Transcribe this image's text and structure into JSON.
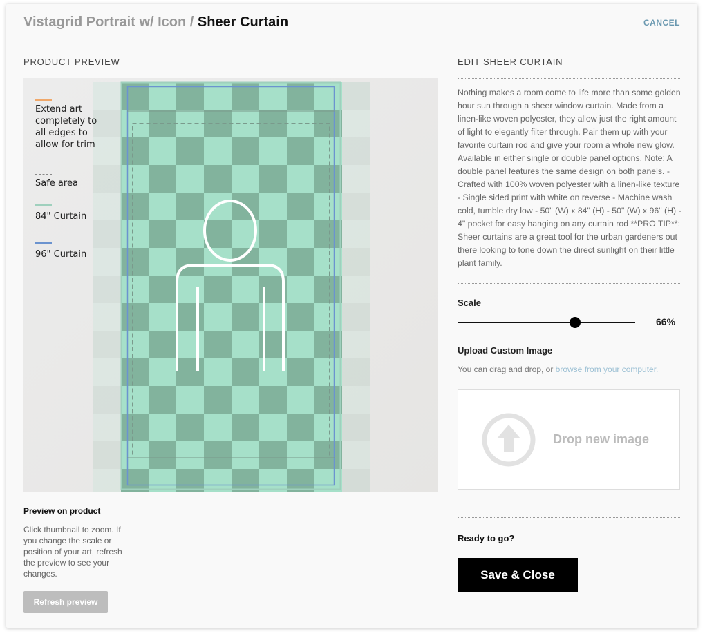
{
  "header": {
    "breadcrumb": "Vistagrid Portrait w/ Icon /",
    "title": "Sheer Curtain",
    "cancel_label": "CANCEL"
  },
  "preview": {
    "section_label": "PRODUCT PREVIEW",
    "legend": {
      "extend_art": "Extend art completely to all edges to allow for trim",
      "safe_area": "Safe area",
      "curtain_84": "84\" Curtain",
      "curtain_96": "96\" Curtain"
    },
    "colors": {
      "extend_art": "#f0a86a",
      "curtain_84": "#9fd0bd",
      "curtain_96": "#6b93cf",
      "check_light": "#a6e0c9",
      "check_dark": "#82b39d"
    },
    "icons": [
      "person-icon"
    ],
    "caption": "Preview on product",
    "help": "Click thumbnail to zoom. If you change the scale or position of your art, refresh the preview to see your changes.",
    "refresh_label": "Refresh preview"
  },
  "editor": {
    "section_label": "EDIT SHEER CURTAIN",
    "description": "Nothing makes a room come to life more than some golden hour sun through a sheer window curtain. Made from a linen-like woven polyester, they allow just the right amount of light to elegantly filter through. Pair them up with your favorite curtain rod and give your room a whole new glow. Available in either single or double panel options. Note: A double panel features the same design on both panels. - Crafted with 100% woven polyester with a linen-like texture - Single sided print with white on reverse - Machine wash cold, tumble dry low - 50\" (W) x 84\" (H) - 50\" (W) x 96\" (H) - 4\" pocket for easy hanging on any curtain rod **PRO TIP**: Sheer curtains are a great tool for the urban gardeners out there looking to tone down the direct sunlight on their little plant family.",
    "scale": {
      "label": "Scale",
      "value": 66,
      "value_text": "66%"
    },
    "upload": {
      "label": "Upload Custom Image",
      "help_prefix": "You can drag and drop, or ",
      "help_link": "browse from your computer.",
      "drop_text": "Drop new image",
      "icon": "upload-arrow-icon"
    },
    "ready_label": "Ready to go?",
    "save_label": "Save & Close"
  }
}
